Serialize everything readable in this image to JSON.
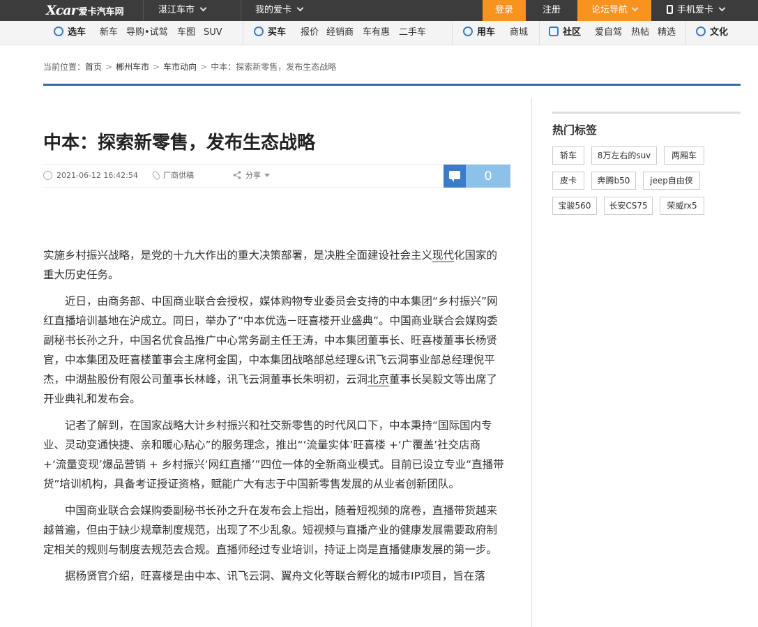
{
  "topbar": {
    "logo_mark": "Xcar",
    "logo_text": "爱卡汽车网",
    "city": "湛江车市",
    "my_xcar": "我的爱卡",
    "login": "登录",
    "register": "注册",
    "forum_nav": "论坛导航",
    "mobile": "手机爱卡"
  },
  "nav": {
    "select_car": "选车",
    "new_car": "新车",
    "guide": "导购•试驾",
    "gallery": "车图",
    "suv": "SUV",
    "buy_car": "买车",
    "price": "报价",
    "dealer": "经销商",
    "deals": "车有惠",
    "used": "二手车",
    "use_car": "用车",
    "mall": "商城",
    "community": "社区",
    "self_drive": "爱自驾",
    "hot_posts": "热帖",
    "featured": "精选",
    "culture": "文化"
  },
  "breadcrumb": {
    "label": "当前位置：",
    "home": "首页",
    "city": "郴州车市",
    "news": "车市动向",
    "current": "中本：探索新零售，发布生态战略"
  },
  "article": {
    "title": "中本：探索新零售，发布生态战略",
    "date": "2021-06-12 16:42:54",
    "source": "厂商供稿",
    "share": "分享",
    "comments": "0",
    "p1_a": " 实施乡村振兴战略，是党的十九大作出的重大决策部署，是决胜全面建设社会主义",
    "p1_link": "现代",
    "p1_b": "化国家的重大历史任务。",
    "p2_a": "　　近日，由商务部、中国商业联合会授权，媒体购物专业委员会支持的中本集团“乡村振兴”网红直播培训基地在沪成立。同日，举办了“中本优选－旺喜楼开业盛典”。中国商业联合会媒购委副秘书长孙之升，中国名优食品推广中心常务副主任王涛，中本集团董事长、旺喜楼董事长杨贤官，中本集团及旺喜楼董事会主席柯金国，中本集团战略部总经理&讯飞云洞事业部总经理倪平杰，中湖盐股份有限公司董事长林峰，讯飞云洞董事长朱明初，云洞",
    "p2_link": "北京",
    "p2_b": "董事长吴毅文等出席了开业典礼和发布会。",
    "p3": "　　记者了解到，在国家战略大计乡村振兴和社交新零售的时代风口下，中本秉持“国际国内专业、灵动变通快捷、亲和暖心贴心”的服务理念，推出“‘流量实体’旺喜楼 +‘广覆盖’社交店商 +‘流量变现’爆品营销 + 乡村振兴‘网红直播’”四位一体的全新商业模式。目前已设立专业“直播带货”培训机构，具备考证授证资格，赋能广大有志于中国新零售发展的从业者创新团队。",
    "p4": "　　中国商业联合会媒购委副秘书长孙之升在发布会上指出，随着短视频的席卷，直播带货越来越普遍，但由于缺少规章制度规范，出现了不少乱象。短视频与直播产业的健康发展需要政府制定相关的规则与制度去规范去合规。直播师经过专业培训，持证上岗是直播健康发展的第一步。",
    "p5": "　　据杨贤官介绍，旺喜楼是由中本、讯飞云洞、翼舟文化等联合孵化的城市IP项目，旨在落"
  },
  "sidebar": {
    "title": "热门标签",
    "tags": [
      "轿车",
      "8万左右的suv",
      "两厢车",
      "皮卡",
      "奔腾b50",
      "jeep自由侠",
      "宝骏560",
      "长安CS75",
      "荣威rx5"
    ]
  },
  "colors": {
    "topbar_bg": "#3c3c3c",
    "orange": "#f7931e",
    "accent_blue": "#3a6da4",
    "comment_blue": "#8cc1e9"
  }
}
